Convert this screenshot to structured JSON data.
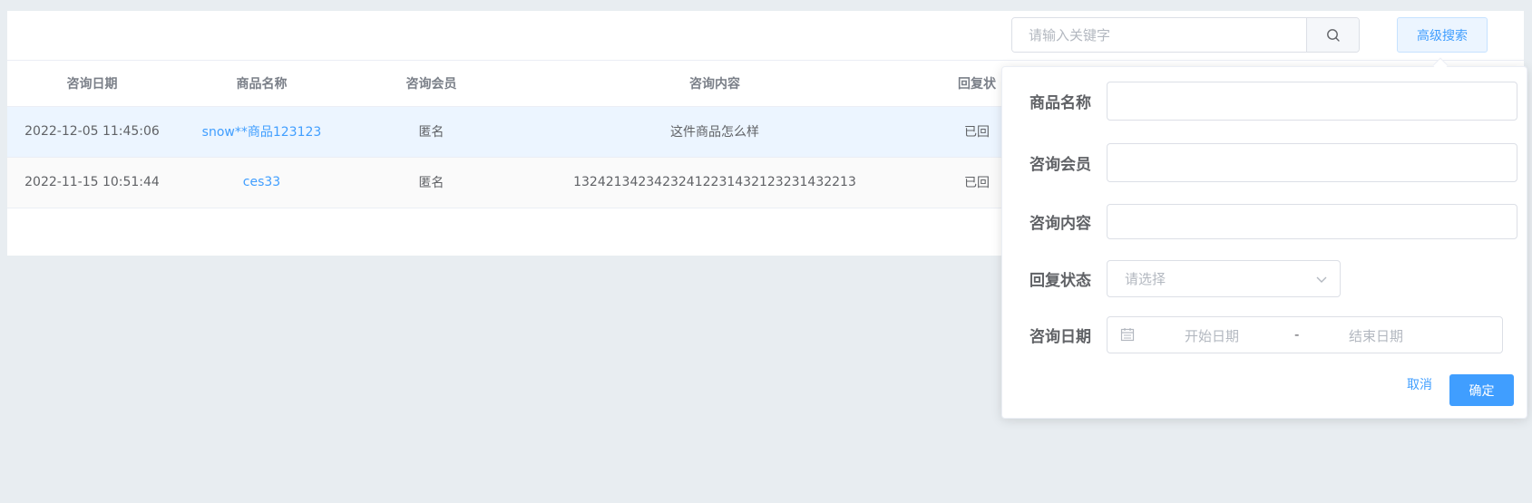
{
  "toolbar": {
    "search_placeholder": "请输入关键字",
    "search_icon": "search-icon",
    "advanced_search_label": "高级搜索"
  },
  "table": {
    "columns": [
      "咨询日期",
      "商品名称",
      "咨询会员",
      "咨询内容",
      "回复状"
    ],
    "rows": [
      {
        "date": "2022-12-05 11:45:06",
        "product": "snow**商品123123",
        "member": "匿名",
        "content": "这件商品怎么样",
        "status": "已回"
      },
      {
        "date": "2022-11-15 10:51:44",
        "product": "ces33",
        "member": "匿名",
        "content": "13242134234232412231432123231432213",
        "status": "已回"
      }
    ]
  },
  "advanced_search": {
    "product_name_label": "商品名称",
    "member_label": "咨询会员",
    "content_label": "咨询内容",
    "status_label": "回复状态",
    "status_placeholder": "请选择",
    "date_label": "咨询日期",
    "date_start_placeholder": "开始日期",
    "date_separator": "-",
    "date_end_placeholder": "结束日期",
    "cancel_label": "取消",
    "confirm_label": "确定"
  },
  "colors": {
    "accent": "#409eff",
    "background": "#e8edf1",
    "highlight_row": "#ecf5ff"
  }
}
